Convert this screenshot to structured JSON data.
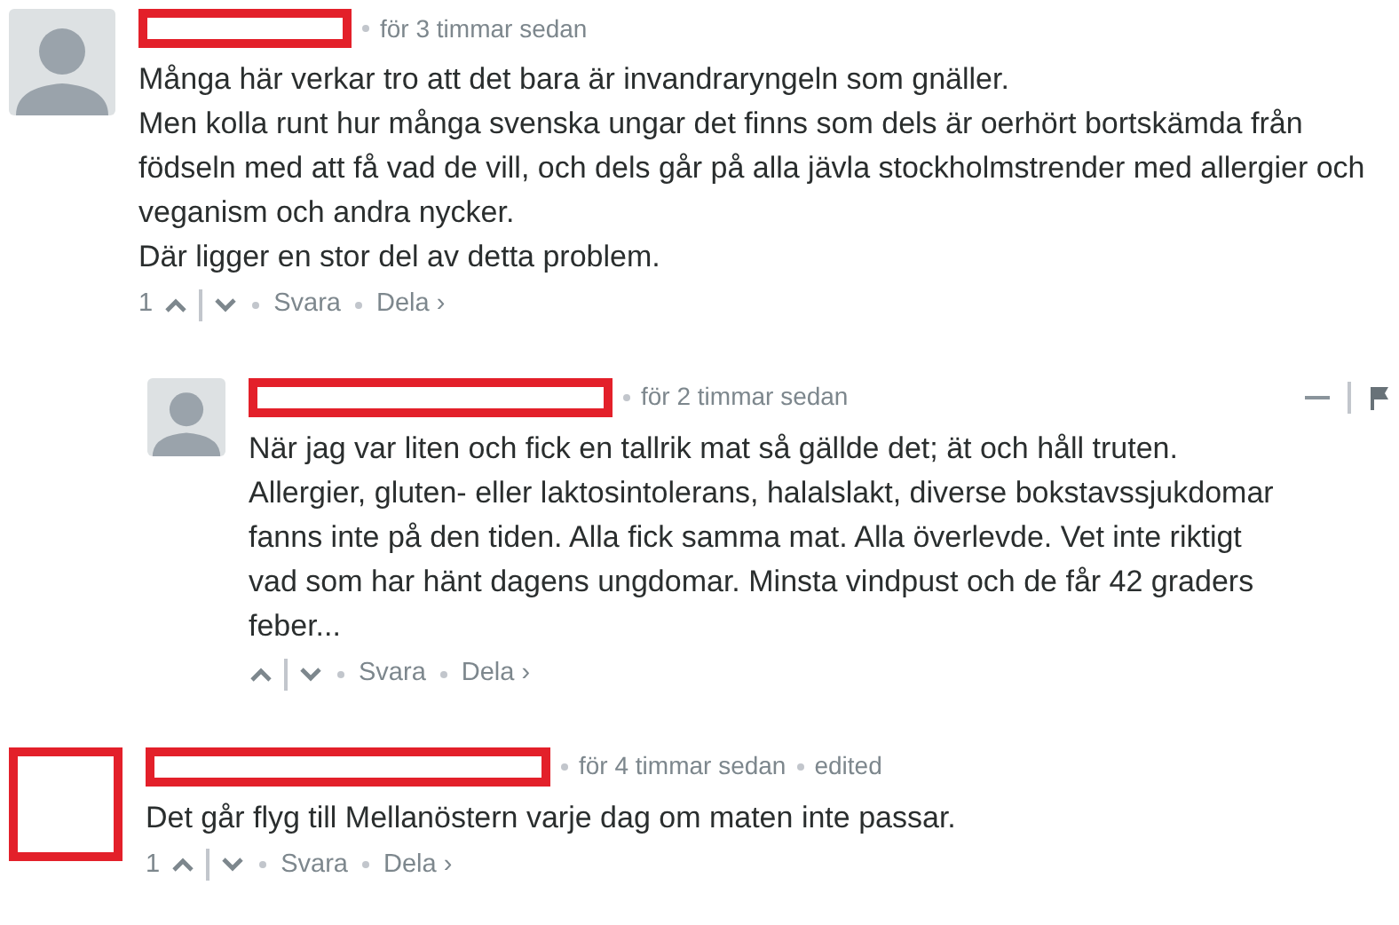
{
  "comments": [
    {
      "avatar": {
        "kind": "default"
      },
      "author_redacted": true,
      "time": "för 3 timmar sedan",
      "paragraphs": [
        "Många här verkar tro att det bara är invandraryngeln som gnäller.",
        "Men kolla runt hur många svenska ungar det finns som dels är oerhört bortskämda från födseln med att få vad de vill, och dels går på alla jävla stockholmstrender med allergier och veganism och andra nycker.",
        "Där ligger en stor del av detta problem."
      ],
      "votes": "1",
      "reply": "Svara",
      "share": "Dela ›",
      "hover_tools": false,
      "children": [
        {
          "avatar": {
            "kind": "default"
          },
          "author_redacted": true,
          "time": "för 2 timmar sedan",
          "paragraphs": [
            "När jag var liten och fick en tallrik mat så gällde det; ät och håll truten. Allergier, gluten- eller laktosintolerans, halalslakt, diverse bokstavssjukdomar fanns inte på den tiden. Alla fick samma mat. Alla överlevde. Vet inte riktigt vad som har hänt dagens ungdomar. Minsta vindpust och de får 42 graders feber..."
          ],
          "reply": "Svara",
          "share": "Dela ›",
          "hover_tools": true
        }
      ]
    },
    {
      "avatar": {
        "kind": "redacted"
      },
      "author_redacted": true,
      "time": "för 4 timmar sedan",
      "edited": "edited",
      "paragraphs": [
        "Det går flyg till Mellanöstern varje dag om maten inte passar."
      ],
      "votes": "1",
      "reply": "Svara",
      "share": "Dela ›",
      "hover_tools": false
    }
  ]
}
